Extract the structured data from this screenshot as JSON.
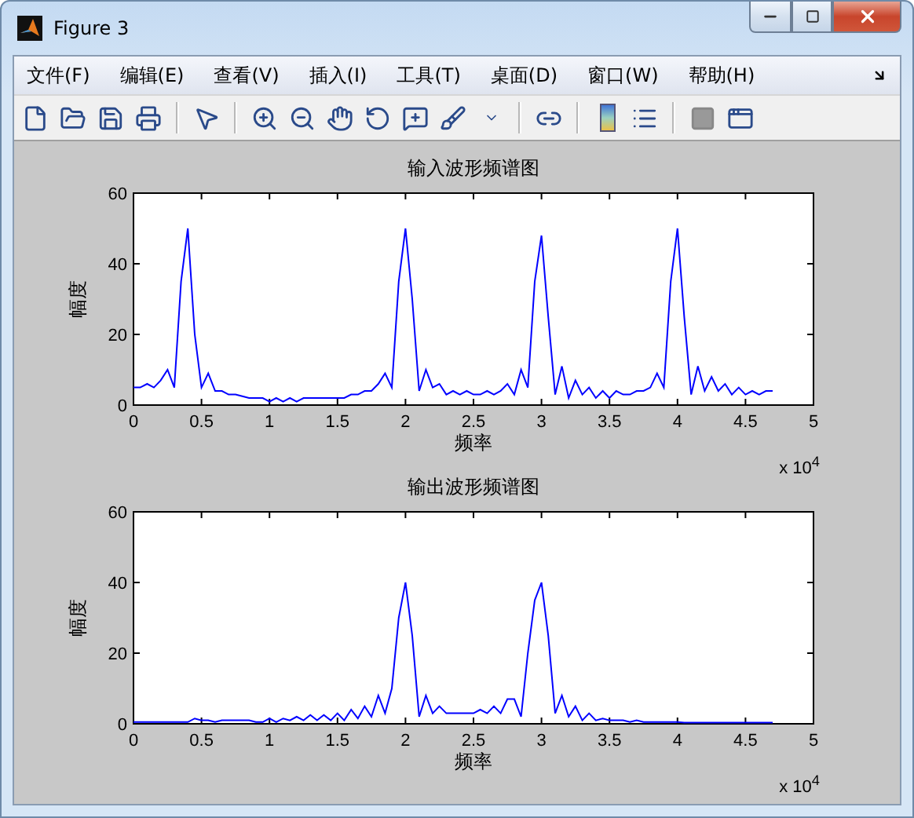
{
  "window": {
    "title": "Figure 3"
  },
  "menu": [
    "文件(F)",
    "编辑(E)",
    "查看(V)",
    "插入(I)",
    "工具(T)",
    "桌面(D)",
    "窗口(W)",
    "帮助(H)"
  ],
  "figure": {
    "panels": [
      {
        "x_multiplier": "x 10$^{4}$",
        "chart_data": {
          "type": "line",
          "title": "输入波形频谱图",
          "xlabel": "频率",
          "ylabel": "幅度",
          "x": [
            0,
            0.05,
            0.1,
            0.15,
            0.2,
            0.25,
            0.3,
            0.35,
            0.4,
            0.45,
            0.5,
            0.55,
            0.6,
            0.65,
            0.7,
            0.75,
            0.8,
            0.85,
            0.9,
            0.95,
            1,
            1.05,
            1.1,
            1.15,
            1.2,
            1.25,
            1.3,
            1.35,
            1.4,
            1.45,
            1.5,
            1.55,
            1.6,
            1.65,
            1.7,
            1.75,
            1.8,
            1.85,
            1.9,
            1.95,
            2,
            2.05,
            2.1,
            2.15,
            2.2,
            2.25,
            2.3,
            2.35,
            2.4,
            2.45,
            2.5,
            2.55,
            2.6,
            2.65,
            2.7,
            2.75,
            2.8,
            2.85,
            2.9,
            2.95,
            3,
            3.05,
            3.1,
            3.15,
            3.2,
            3.25,
            3.3,
            3.35,
            3.4,
            3.45,
            3.5,
            3.55,
            3.6,
            3.65,
            3.7,
            3.75,
            3.8,
            3.85,
            3.9,
            3.95,
            4,
            4.05,
            4.1,
            4.15,
            4.2,
            4.25,
            4.3,
            4.35,
            4.4,
            4.45,
            4.5,
            4.55,
            4.6,
            4.65,
            4.7
          ],
          "series": [
            {
              "color": "#0000ff",
              "values": [
                5,
                5,
                6,
                5,
                7,
                10,
                5,
                35,
                50,
                20,
                5,
                9,
                4,
                4,
                3,
                3,
                2.5,
                2,
                2,
                2,
                1,
                2,
                1,
                2,
                1,
                2,
                2,
                2,
                2,
                2,
                2,
                2,
                3,
                3,
                4,
                4,
                6,
                9,
                5,
                35,
                50,
                30,
                4,
                10,
                5,
                6,
                3,
                4,
                3,
                4,
                3,
                3,
                4,
                3,
                4,
                6,
                3,
                10,
                5,
                35,
                48,
                25,
                3,
                11,
                2,
                7,
                3,
                5,
                2,
                4,
                2,
                4,
                3,
                3,
                4,
                4,
                5,
                9,
                5,
                35,
                50,
                25,
                3,
                11,
                4,
                8,
                4,
                6,
                3,
                5,
                3,
                4,
                3,
                4,
                4
              ]
            }
          ],
          "xlim": [
            0,
            5
          ],
          "ylim": [
            0,
            60
          ],
          "xticks": [
            0,
            0.5,
            1,
            1.5,
            2,
            2.5,
            3,
            3.5,
            4,
            4.5,
            5
          ],
          "yticks": [
            0,
            20,
            40,
            60
          ]
        }
      },
      {
        "x_multiplier": "x 10$^{4}$",
        "chart_data": {
          "type": "line",
          "title": "输出波形频谱图",
          "xlabel": "频率",
          "ylabel": "幅度",
          "x": [
            0,
            0.05,
            0.1,
            0.15,
            0.2,
            0.25,
            0.3,
            0.35,
            0.4,
            0.45,
            0.5,
            0.55,
            0.6,
            0.65,
            0.7,
            0.75,
            0.8,
            0.85,
            0.9,
            0.95,
            1,
            1.05,
            1.1,
            1.15,
            1.2,
            1.25,
            1.3,
            1.35,
            1.4,
            1.45,
            1.5,
            1.55,
            1.6,
            1.65,
            1.7,
            1.75,
            1.8,
            1.85,
            1.9,
            1.95,
            2,
            2.05,
            2.1,
            2.15,
            2.2,
            2.25,
            2.3,
            2.35,
            2.4,
            2.45,
            2.5,
            2.55,
            2.6,
            2.65,
            2.7,
            2.75,
            2.8,
            2.85,
            2.9,
            2.95,
            3,
            3.05,
            3.1,
            3.15,
            3.2,
            3.25,
            3.3,
            3.35,
            3.4,
            3.45,
            3.5,
            3.55,
            3.6,
            3.65,
            3.7,
            3.75,
            3.8,
            3.85,
            3.9,
            3.95,
            4,
            4.05,
            4.1,
            4.15,
            4.2,
            4.25,
            4.3,
            4.35,
            4.4,
            4.45,
            4.5,
            4.55,
            4.6,
            4.65,
            4.7
          ],
          "series": [
            {
              "color": "#0000ff",
              "values": [
                0.5,
                0.5,
                0.5,
                0.5,
                0.5,
                0.5,
                0.5,
                0.5,
                0.5,
                1.5,
                1,
                1,
                0.5,
                1,
                1,
                1,
                1,
                1,
                0.5,
                0.5,
                1.5,
                0.5,
                1.5,
                1,
                2,
                1,
                2.5,
                1,
                2.5,
                1,
                3,
                1,
                4,
                1.5,
                5,
                2,
                8,
                3,
                10,
                30,
                40,
                25,
                2,
                8,
                3,
                5,
                3,
                3,
                3,
                3,
                3,
                4,
                3,
                5,
                3,
                7,
                7,
                2,
                20,
                35,
                40,
                25,
                3,
                8,
                2,
                5,
                1,
                3,
                1,
                1.5,
                1,
                1,
                1,
                0.5,
                1,
                0.5,
                0.5,
                0.5,
                0.5,
                0.5,
                0.5,
                0.3,
                0.3,
                0.3,
                0.3,
                0.3,
                0.3,
                0.3,
                0.3,
                0.3,
                0.3,
                0.3,
                0.3,
                0.3,
                0.3
              ]
            }
          ],
          "xlim": [
            0,
            5
          ],
          "ylim": [
            0,
            60
          ],
          "xticks": [
            0,
            0.5,
            1,
            1.5,
            2,
            2.5,
            3,
            3.5,
            4,
            4.5,
            5
          ],
          "yticks": [
            0,
            20,
            40,
            60
          ]
        }
      }
    ]
  }
}
